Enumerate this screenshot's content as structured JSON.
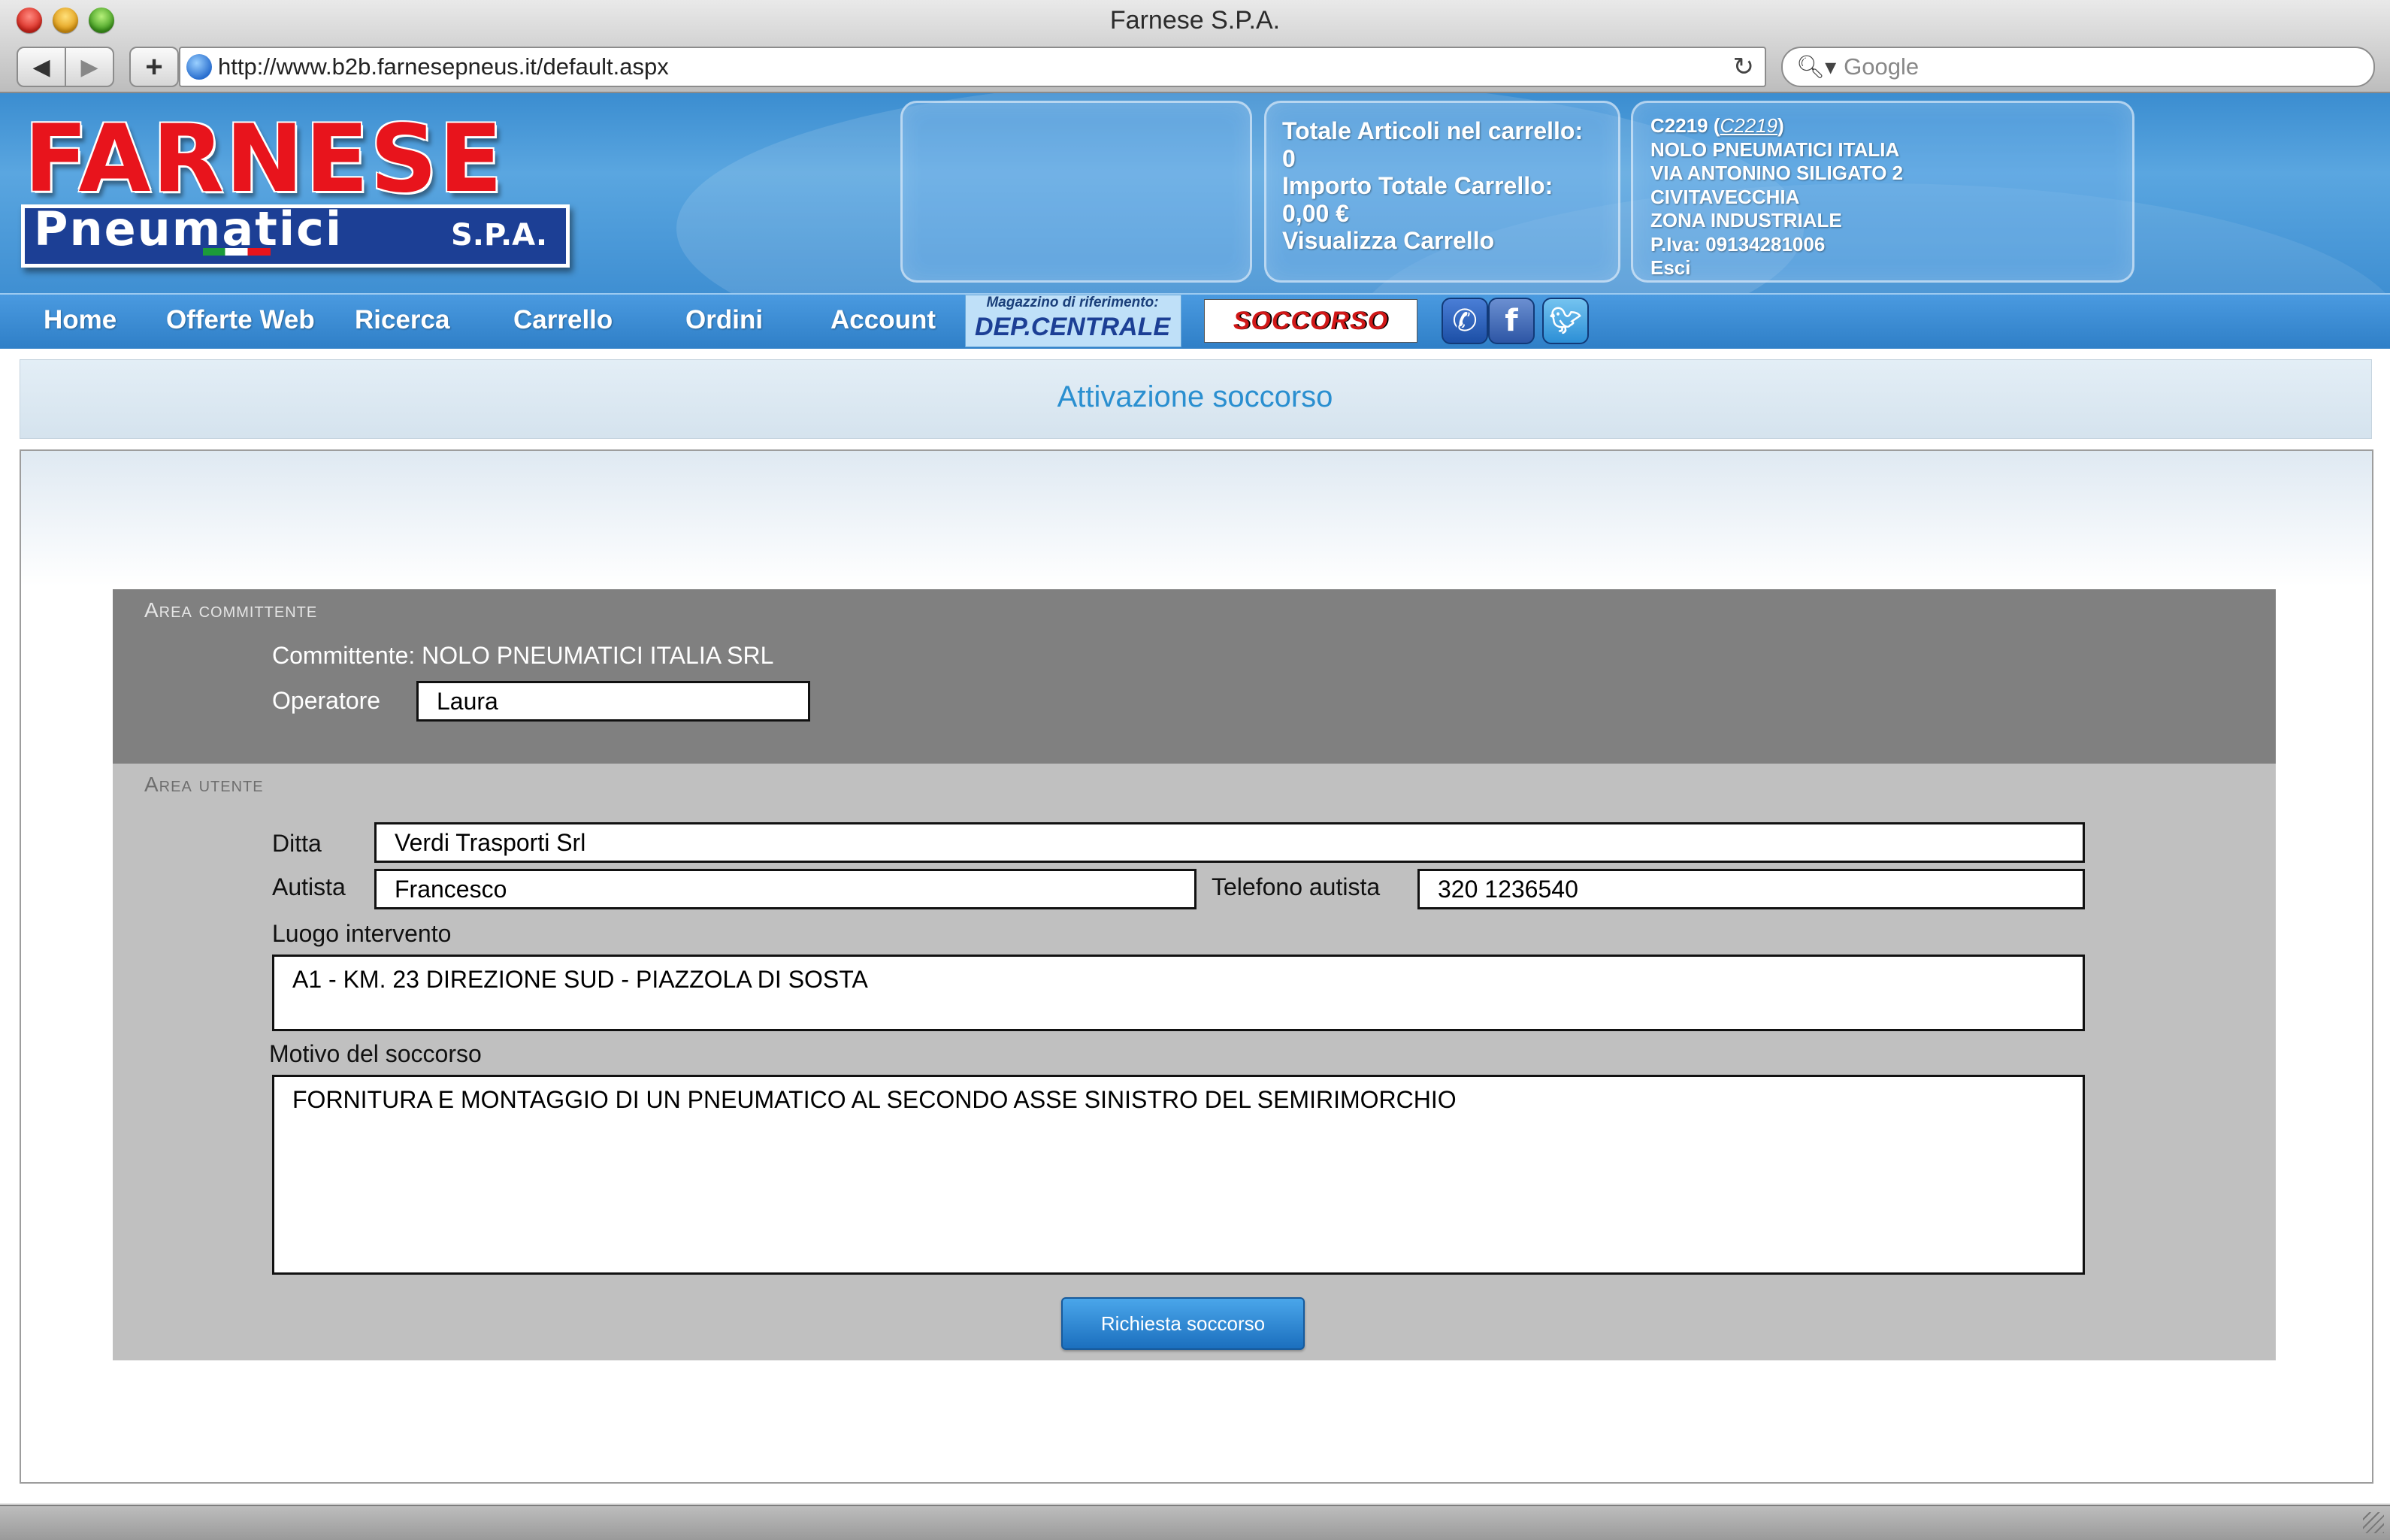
{
  "browser": {
    "window_title": "Farnese S.P.A.",
    "url": "http://www.b2b.farnesepneus.it/default.aspx",
    "search_placeholder": "Google"
  },
  "logo": {
    "top": "FARNESE",
    "bottom": "Pneumatici",
    "suffix": "S.P.A."
  },
  "cart": {
    "items_label": "Totale Articoli nel carrello:",
    "items_value": "0",
    "total_label": "Importo Totale Carrello:",
    "total_value": "0,00 €",
    "view_link": "Visualizza Carrello"
  },
  "customer": {
    "code": "C2219",
    "code_link": "C2219",
    "name": "NOLO PNEUMATICI ITALIA",
    "address": "VIA ANTONINO SILIGATO 2",
    "city": "CIVITAVECCHIA",
    "zone": "ZONA INDUSTRIALE",
    "vat": "P.Iva: 09134281006",
    "logout": "Esci"
  },
  "menu": {
    "items": [
      {
        "label": "Home"
      },
      {
        "label": "Offerte Web"
      },
      {
        "label": "Ricerca"
      },
      {
        "label": "Carrello"
      },
      {
        "label": "Ordini"
      },
      {
        "label": "Account"
      }
    ],
    "warehouse_label": "Magazzino di riferimento:",
    "warehouse_value": "DEP.CENTRALE",
    "soccorso_banner": "SOCCORSO",
    "icons": [
      "phone-icon",
      "facebook-icon",
      "twitter-icon"
    ]
  },
  "page": {
    "title": "Attivazione soccorso"
  },
  "area_committente": {
    "heading": "Area committente",
    "committente": "Committente: NOLO PNEUMATICI ITALIA SRL",
    "operatore_label": "Operatore",
    "operatore_value": "Laura"
  },
  "area_utente": {
    "heading": "Area utente",
    "ditta_label": "Ditta",
    "ditta_value": "Verdi Trasporti Srl",
    "autista_label": "Autista",
    "autista_value": "Francesco",
    "telefono_label": "Telefono autista",
    "telefono_value": "320 1236540",
    "luogo_label": "Luogo intervento",
    "luogo_value": "A1 - KM. 23 DIREZIONE SUD - PIAZZOLA DI SOSTA",
    "motivo_label": "Motivo del soccorso",
    "motivo_value": "FORNITURA E MONTAGGIO DI UN PNEUMATICO AL SECONDO ASSE SINISTRO DEL SEMIRIMORCHIO",
    "submit_label": "Richiesta soccorso"
  },
  "colors": {
    "header_blue": "#3f8fd2",
    "title_blue": "#2a8fd0",
    "logo_red": "#e8141c",
    "logo_navy": "#1c3f95",
    "area_dark": "#808080",
    "area_light": "#c0c0c0"
  }
}
